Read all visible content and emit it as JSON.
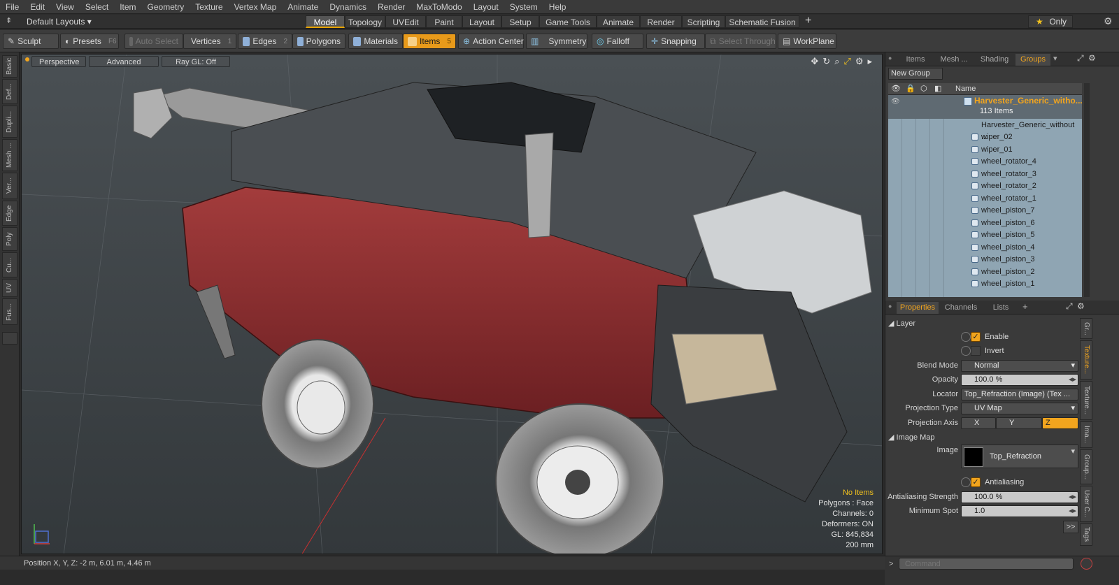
{
  "menu": [
    "File",
    "Edit",
    "View",
    "Select",
    "Item",
    "Geometry",
    "Texture",
    "Vertex Map",
    "Animate",
    "Dynamics",
    "Render",
    "MaxToModo",
    "Layout",
    "System",
    "Help"
  ],
  "layout_selector": "Default Layouts ▾",
  "layout_tabs": [
    "Model",
    "Topology",
    "UVEdit",
    "Paint",
    "Layout",
    "Setup",
    "Game Tools",
    "Animate",
    "Render",
    "Scripting",
    "Schematic Fusion"
  ],
  "add_tab": "+",
  "only_label": "Only",
  "toolbar": {
    "sculpt": "Sculpt",
    "presets": "Presets",
    "presets_key": "F6",
    "auto_select": "Auto Select",
    "vertices": "Vertices",
    "vertices_key": "1",
    "edges": "Edges",
    "edges_key": "2",
    "polygons": "Polygons",
    "materials": "Materials",
    "items": "Items",
    "items_key": "5",
    "action_center": "Action Center",
    "symmetry": "Symmetry",
    "falloff": "Falloff",
    "snapping": "Snapping",
    "select_through": "Select Through",
    "workplane": "WorkPlane"
  },
  "left_tabs": [
    "Basic",
    "Def...",
    "Dupli...",
    "Mesh ...",
    "Ver...",
    "Edge",
    "Poly",
    "Cu...",
    "UV",
    "Fus..."
  ],
  "viewport": {
    "perspective": "Perspective",
    "advanced": "Advanced",
    "raygl": "Ray GL: Off",
    "info": {
      "no_items": "No Items",
      "polygons": "Polygons : Face",
      "channels": "Channels: 0",
      "deformers": "Deformers: ON",
      "gl": "GL: 845,834",
      "scale": "200 mm"
    }
  },
  "status": "Position X, Y, Z:  -2 m, 6.01 m, 4.46 m",
  "groups_panel": {
    "tabs": [
      "Items",
      "Mesh ...",
      "Shading",
      "Groups"
    ],
    "new_group": "New Group",
    "name_header": "Name",
    "root_name": "Harvester_Generic_witho...",
    "root_count": "113 Items",
    "items": [
      "Harvester_Generic_without ...",
      "wiper_02",
      "wiper_01",
      "wheel_rotator_4",
      "wheel_rotator_3",
      "wheel_rotator_2",
      "wheel_rotator_1",
      "wheel_piston_7",
      "wheel_piston_6",
      "wheel_piston_5",
      "wheel_piston_4",
      "wheel_piston_3",
      "wheel_piston_2",
      "wheel_piston_1"
    ]
  },
  "properties": {
    "tabs": [
      "Properties",
      "Channels",
      "Lists"
    ],
    "add": "+",
    "layer_header": "Layer",
    "enable": "Enable",
    "invert": "Invert",
    "blend_mode_label": "Blend Mode",
    "blend_mode": "Normal",
    "opacity_label": "Opacity",
    "opacity": "100.0 %",
    "locator_label": "Locator",
    "locator": "Top_Refraction (Image) (Tex ...",
    "projection_type_label": "Projection Type",
    "projection_type": "UV Map",
    "projection_axis_label": "Projection Axis",
    "axis_x": "X",
    "axis_y": "Y",
    "axis_z": "Z",
    "image_map_header": "Image Map",
    "image_label": "Image",
    "image": "Top_Refraction",
    "antialiasing": "Antialiasing",
    "aa_strength_label": "Antialiasing Strength",
    "aa_strength": "100.0 %",
    "min_spot_label": "Minimum Spot",
    "min_spot": "1.0",
    "more": ">>"
  },
  "side_tabs": [
    "Gr...",
    "Texture...",
    "Texture...",
    "Ima...",
    "Group...",
    "User C...",
    "Tags"
  ],
  "command_placeholder": "Command",
  "colors": {
    "accent": "#f2a51e",
    "selection": "#8fa5b3",
    "body_red": "#8b2a2a"
  }
}
